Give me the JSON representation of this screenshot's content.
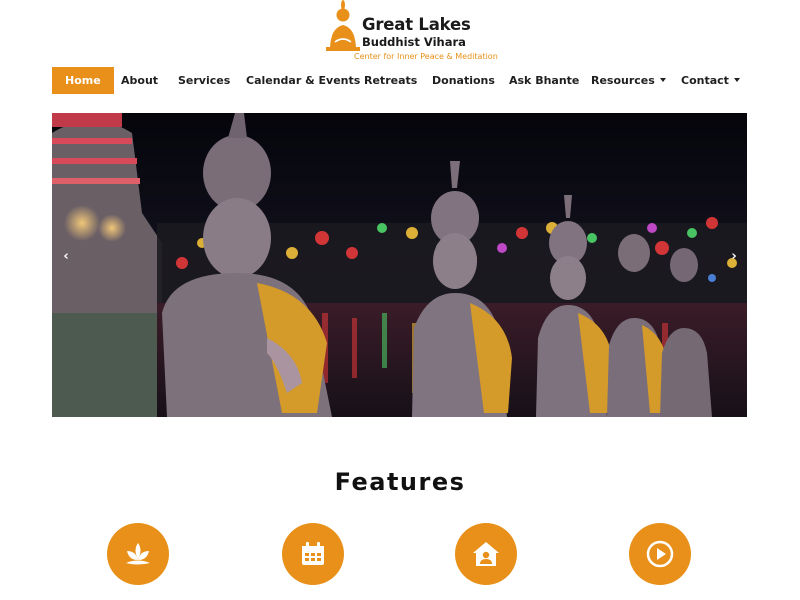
{
  "logo": {
    "line1": "Great Lakes",
    "line2": "Buddhist Vihara",
    "tagline": "Center for Inner Peace & Meditation"
  },
  "nav": {
    "items": [
      {
        "label": "Home",
        "active": true
      },
      {
        "label": "About"
      },
      {
        "label": "Services"
      },
      {
        "label": "Calendar & Events"
      },
      {
        "label": "Retreats"
      },
      {
        "label": "Donations"
      },
      {
        "label": "Ask Bhante"
      },
      {
        "label": "Resources",
        "dropdown": true
      },
      {
        "label": "Contact",
        "dropdown": true
      }
    ]
  },
  "hero": {
    "prev_label": "‹",
    "next_label": "›"
  },
  "features": {
    "title": "Features",
    "icons": [
      "lotus-icon",
      "calendar-icon",
      "house-user-icon",
      "play-circle-icon"
    ]
  },
  "colors": {
    "accent": "#e8901a",
    "text": "#1f1f1f",
    "background": "#ffffff"
  }
}
